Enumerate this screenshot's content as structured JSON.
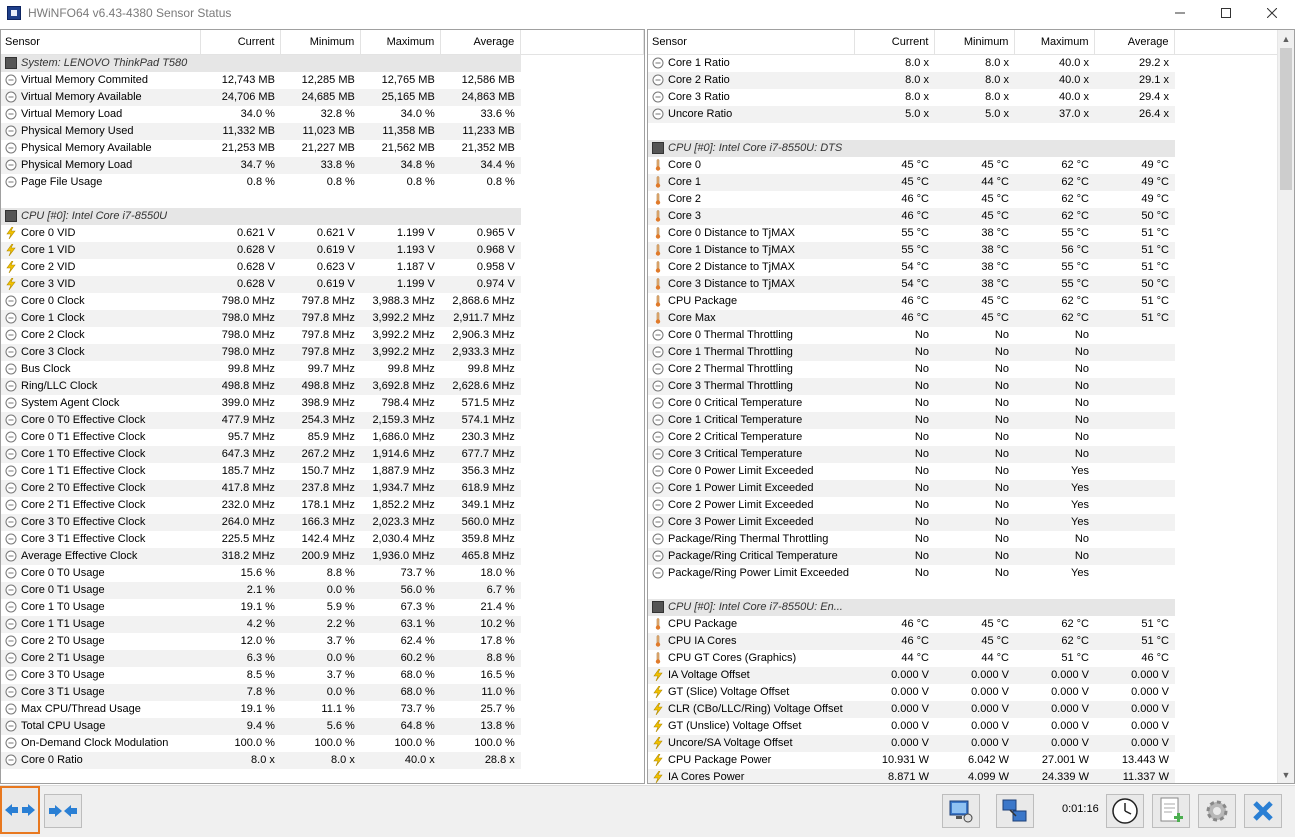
{
  "window": {
    "title": "HWiNFO64 v6.43-4380 Sensor Status",
    "controls": [
      "minimize-icon",
      "maximize-icon",
      "close-icon"
    ]
  },
  "columns": {
    "sensor": "Sensor",
    "current": "Current",
    "minimum": "Minimum",
    "maximum": "Maximum",
    "average": "Average"
  },
  "left_panel": {
    "rows": [
      {
        "type": "group",
        "name": "System: LENOVO ThinkPad T580",
        "icon": "device-icon"
      },
      {
        "type": "row",
        "icon": "clock-icon",
        "name": "Virtual Memory Commited",
        "current": "12,743 MB",
        "minimum": "12,285 MB",
        "maximum": "12,765 MB",
        "average": "12,586 MB"
      },
      {
        "type": "row",
        "icon": "clock-icon",
        "name": "Virtual Memory Available",
        "current": "24,706 MB",
        "minimum": "24,685 MB",
        "maximum": "25,165 MB",
        "average": "24,863 MB"
      },
      {
        "type": "row",
        "icon": "clock-icon",
        "name": "Virtual Memory Load",
        "current": "34.0 %",
        "minimum": "32.8 %",
        "maximum": "34.0 %",
        "average": "33.6 %"
      },
      {
        "type": "row",
        "icon": "clock-icon",
        "name": "Physical Memory Used",
        "current": "11,332 MB",
        "minimum": "11,023 MB",
        "maximum": "11,358 MB",
        "average": "11,233 MB"
      },
      {
        "type": "row",
        "icon": "clock-icon",
        "name": "Physical Memory Available",
        "current": "21,253 MB",
        "minimum": "21,227 MB",
        "maximum": "21,562 MB",
        "average": "21,352 MB"
      },
      {
        "type": "row",
        "icon": "clock-icon",
        "name": "Physical Memory Load",
        "current": "34.7 %",
        "minimum": "33.8 %",
        "maximum": "34.8 %",
        "average": "34.4 %"
      },
      {
        "type": "row",
        "icon": "clock-icon",
        "name": "Page File Usage",
        "current": "0.8 %",
        "minimum": "0.8 %",
        "maximum": "0.8 %",
        "average": "0.8 %"
      },
      {
        "type": "blank"
      },
      {
        "type": "group",
        "name": "CPU [#0]: Intel Core i7-8550U",
        "icon": "device-icon"
      },
      {
        "type": "row",
        "icon": "bolt-icon",
        "name": "Core 0 VID",
        "current": "0.621 V",
        "minimum": "0.621 V",
        "maximum": "1.199 V",
        "average": "0.965 V"
      },
      {
        "type": "row",
        "icon": "bolt-icon",
        "name": "Core 1 VID",
        "current": "0.628 V",
        "minimum": "0.619 V",
        "maximum": "1.193 V",
        "average": "0.968 V"
      },
      {
        "type": "row",
        "icon": "bolt-icon",
        "name": "Core 2 VID",
        "current": "0.628 V",
        "minimum": "0.623 V",
        "maximum": "1.187 V",
        "average": "0.958 V"
      },
      {
        "type": "row",
        "icon": "bolt-icon",
        "name": "Core 3 VID",
        "current": "0.628 V",
        "minimum": "0.619 V",
        "maximum": "1.199 V",
        "average": "0.974 V"
      },
      {
        "type": "row",
        "icon": "clock-icon",
        "name": "Core 0 Clock",
        "current": "798.0 MHz",
        "minimum": "797.8 MHz",
        "maximum": "3,988.3 MHz",
        "average": "2,868.6 MHz"
      },
      {
        "type": "row",
        "icon": "clock-icon",
        "name": "Core 1 Clock",
        "current": "798.0 MHz",
        "minimum": "797.8 MHz",
        "maximum": "3,992.2 MHz",
        "average": "2,911.7 MHz"
      },
      {
        "type": "row",
        "icon": "clock-icon",
        "name": "Core 2 Clock",
        "current": "798.0 MHz",
        "minimum": "797.8 MHz",
        "maximum": "3,992.2 MHz",
        "average": "2,906.3 MHz"
      },
      {
        "type": "row",
        "icon": "clock-icon",
        "name": "Core 3 Clock",
        "current": "798.0 MHz",
        "minimum": "797.8 MHz",
        "maximum": "3,992.2 MHz",
        "average": "2,933.3 MHz"
      },
      {
        "type": "row",
        "icon": "clock-icon",
        "name": "Bus Clock",
        "current": "99.8 MHz",
        "minimum": "99.7 MHz",
        "maximum": "99.8 MHz",
        "average": "99.8 MHz"
      },
      {
        "type": "row",
        "icon": "clock-icon",
        "name": "Ring/LLC Clock",
        "current": "498.8 MHz",
        "minimum": "498.8 MHz",
        "maximum": "3,692.8 MHz",
        "average": "2,628.6 MHz"
      },
      {
        "type": "row",
        "icon": "clock-icon",
        "name": "System Agent Clock",
        "current": "399.0 MHz",
        "minimum": "398.9 MHz",
        "maximum": "798.4 MHz",
        "average": "571.5 MHz"
      },
      {
        "type": "row",
        "icon": "clock-icon",
        "name": "Core 0 T0 Effective Clock",
        "current": "477.9 MHz",
        "minimum": "254.3 MHz",
        "maximum": "2,159.3 MHz",
        "average": "574.1 MHz"
      },
      {
        "type": "row",
        "icon": "clock-icon",
        "name": "Core 0 T1 Effective Clock",
        "current": "95.7 MHz",
        "minimum": "85.9 MHz",
        "maximum": "1,686.0 MHz",
        "average": "230.3 MHz"
      },
      {
        "type": "row",
        "icon": "clock-icon",
        "name": "Core 1 T0 Effective Clock",
        "current": "647.3 MHz",
        "minimum": "267.2 MHz",
        "maximum": "1,914.6 MHz",
        "average": "677.7 MHz"
      },
      {
        "type": "row",
        "icon": "clock-icon",
        "name": "Core 1 T1 Effective Clock",
        "current": "185.7 MHz",
        "minimum": "150.7 MHz",
        "maximum": "1,887.9 MHz",
        "average": "356.3 MHz"
      },
      {
        "type": "row",
        "icon": "clock-icon",
        "name": "Core 2 T0 Effective Clock",
        "current": "417.8 MHz",
        "minimum": "237.8 MHz",
        "maximum": "1,934.7 MHz",
        "average": "618.9 MHz"
      },
      {
        "type": "row",
        "icon": "clock-icon",
        "name": "Core 2 T1 Effective Clock",
        "current": "232.0 MHz",
        "minimum": "178.1 MHz",
        "maximum": "1,852.2 MHz",
        "average": "349.1 MHz"
      },
      {
        "type": "row",
        "icon": "clock-icon",
        "name": "Core 3 T0 Effective Clock",
        "current": "264.0 MHz",
        "minimum": "166.3 MHz",
        "maximum": "2,023.3 MHz",
        "average": "560.0 MHz"
      },
      {
        "type": "row",
        "icon": "clock-icon",
        "name": "Core 3 T1 Effective Clock",
        "current": "225.5 MHz",
        "minimum": "142.4 MHz",
        "maximum": "2,030.4 MHz",
        "average": "359.8 MHz"
      },
      {
        "type": "row",
        "icon": "clock-icon",
        "name": "Average Effective Clock",
        "current": "318.2 MHz",
        "minimum": "200.9 MHz",
        "maximum": "1,936.0 MHz",
        "average": "465.8 MHz"
      },
      {
        "type": "row",
        "icon": "clock-icon",
        "name": "Core 0 T0 Usage",
        "current": "15.6 %",
        "minimum": "8.8 %",
        "maximum": "73.7 %",
        "average": "18.0 %"
      },
      {
        "type": "row",
        "icon": "clock-icon",
        "name": "Core 0 T1 Usage",
        "current": "2.1 %",
        "minimum": "0.0 %",
        "maximum": "56.0 %",
        "average": "6.7 %"
      },
      {
        "type": "row",
        "icon": "clock-icon",
        "name": "Core 1 T0 Usage",
        "current": "19.1 %",
        "minimum": "5.9 %",
        "maximum": "67.3 %",
        "average": "21.4 %"
      },
      {
        "type": "row",
        "icon": "clock-icon",
        "name": "Core 1 T1 Usage",
        "current": "4.2 %",
        "minimum": "2.2 %",
        "maximum": "63.1 %",
        "average": "10.2 %"
      },
      {
        "type": "row",
        "icon": "clock-icon",
        "name": "Core 2 T0 Usage",
        "current": "12.0 %",
        "minimum": "3.7 %",
        "maximum": "62.4 %",
        "average": "17.8 %"
      },
      {
        "type": "row",
        "icon": "clock-icon",
        "name": "Core 2 T1 Usage",
        "current": "6.3 %",
        "minimum": "0.0 %",
        "maximum": "60.2 %",
        "average": "8.8 %"
      },
      {
        "type": "row",
        "icon": "clock-icon",
        "name": "Core 3 T0 Usage",
        "current": "8.5 %",
        "minimum": "3.7 %",
        "maximum": "68.0 %",
        "average": "16.5 %"
      },
      {
        "type": "row",
        "icon": "clock-icon",
        "name": "Core 3 T1 Usage",
        "current": "7.8 %",
        "minimum": "0.0 %",
        "maximum": "68.0 %",
        "average": "11.0 %"
      },
      {
        "type": "row",
        "icon": "clock-icon",
        "name": "Max CPU/Thread Usage",
        "current": "19.1 %",
        "minimum": "11.1 %",
        "maximum": "73.7 %",
        "average": "25.7 %"
      },
      {
        "type": "row",
        "icon": "clock-icon",
        "name": "Total CPU Usage",
        "current": "9.4 %",
        "minimum": "5.6 %",
        "maximum": "64.8 %",
        "average": "13.8 %"
      },
      {
        "type": "row",
        "icon": "clock-icon",
        "name": "On-Demand Clock Modulation",
        "current": "100.0 %",
        "minimum": "100.0 %",
        "maximum": "100.0 %",
        "average": "100.0 %"
      },
      {
        "type": "row",
        "icon": "clock-icon",
        "name": "Core 0 Ratio",
        "current": "8.0 x",
        "minimum": "8.0 x",
        "maximum": "40.0 x",
        "average": "28.8 x"
      }
    ]
  },
  "right_panel": {
    "rows": [
      {
        "type": "row",
        "icon": "clock-icon",
        "name": "Core 1 Ratio",
        "current": "8.0 x",
        "minimum": "8.0 x",
        "maximum": "40.0 x",
        "average": "29.2 x"
      },
      {
        "type": "row",
        "icon": "clock-icon",
        "name": "Core 2 Ratio",
        "current": "8.0 x",
        "minimum": "8.0 x",
        "maximum": "40.0 x",
        "average": "29.1 x"
      },
      {
        "type": "row",
        "icon": "clock-icon",
        "name": "Core 3 Ratio",
        "current": "8.0 x",
        "minimum": "8.0 x",
        "maximum": "40.0 x",
        "average": "29.4 x"
      },
      {
        "type": "row",
        "icon": "clock-icon",
        "name": "Uncore Ratio",
        "current": "5.0 x",
        "minimum": "5.0 x",
        "maximum": "37.0 x",
        "average": "26.4 x"
      },
      {
        "type": "blank"
      },
      {
        "type": "group",
        "name": "CPU [#0]: Intel Core i7-8550U: DTS",
        "icon": "device-icon"
      },
      {
        "type": "row",
        "icon": "thermometer-icon",
        "name": "Core 0",
        "current": "45 °C",
        "minimum": "45 °C",
        "maximum": "62 °C",
        "average": "49 °C"
      },
      {
        "type": "row",
        "icon": "thermometer-icon",
        "name": "Core 1",
        "current": "45 °C",
        "minimum": "44 °C",
        "maximum": "62 °C",
        "average": "49 °C"
      },
      {
        "type": "row",
        "icon": "thermometer-icon",
        "name": "Core 2",
        "current": "46 °C",
        "minimum": "45 °C",
        "maximum": "62 °C",
        "average": "49 °C"
      },
      {
        "type": "row",
        "icon": "thermometer-icon",
        "name": "Core 3",
        "current": "46 °C",
        "minimum": "45 °C",
        "maximum": "62 °C",
        "average": "50 °C"
      },
      {
        "type": "row",
        "icon": "thermometer-icon",
        "name": "Core 0 Distance to TjMAX",
        "current": "55 °C",
        "minimum": "38 °C",
        "maximum": "55 °C",
        "average": "51 °C"
      },
      {
        "type": "row",
        "icon": "thermometer-icon",
        "name": "Core 1 Distance to TjMAX",
        "current": "55 °C",
        "minimum": "38 °C",
        "maximum": "56 °C",
        "average": "51 °C"
      },
      {
        "type": "row",
        "icon": "thermometer-icon",
        "name": "Core 2 Distance to TjMAX",
        "current": "54 °C",
        "minimum": "38 °C",
        "maximum": "55 °C",
        "average": "51 °C"
      },
      {
        "type": "row",
        "icon": "thermometer-icon",
        "name": "Core 3 Distance to TjMAX",
        "current": "54 °C",
        "minimum": "38 °C",
        "maximum": "55 °C",
        "average": "50 °C"
      },
      {
        "type": "row",
        "icon": "thermometer-icon",
        "name": "CPU Package",
        "current": "46 °C",
        "minimum": "45 °C",
        "maximum": "62 °C",
        "average": "51 °C"
      },
      {
        "type": "row",
        "icon": "thermometer-icon",
        "name": "Core Max",
        "current": "46 °C",
        "minimum": "45 °C",
        "maximum": "62 °C",
        "average": "51 °C"
      },
      {
        "type": "row",
        "icon": "clock-icon",
        "name": "Core 0 Thermal Throttling",
        "current": "No",
        "minimum": "No",
        "maximum": "No",
        "average": ""
      },
      {
        "type": "row",
        "icon": "clock-icon",
        "name": "Core 1 Thermal Throttling",
        "current": "No",
        "minimum": "No",
        "maximum": "No",
        "average": ""
      },
      {
        "type": "row",
        "icon": "clock-icon",
        "name": "Core 2 Thermal Throttling",
        "current": "No",
        "minimum": "No",
        "maximum": "No",
        "average": ""
      },
      {
        "type": "row",
        "icon": "clock-icon",
        "name": "Core 3 Thermal Throttling",
        "current": "No",
        "minimum": "No",
        "maximum": "No",
        "average": ""
      },
      {
        "type": "row",
        "icon": "clock-icon",
        "name": "Core 0 Critical Temperature",
        "current": "No",
        "minimum": "No",
        "maximum": "No",
        "average": ""
      },
      {
        "type": "row",
        "icon": "clock-icon",
        "name": "Core 1 Critical Temperature",
        "current": "No",
        "minimum": "No",
        "maximum": "No",
        "average": ""
      },
      {
        "type": "row",
        "icon": "clock-icon",
        "name": "Core 2 Critical Temperature",
        "current": "No",
        "minimum": "No",
        "maximum": "No",
        "average": ""
      },
      {
        "type": "row",
        "icon": "clock-icon",
        "name": "Core 3 Critical Temperature",
        "current": "No",
        "minimum": "No",
        "maximum": "No",
        "average": ""
      },
      {
        "type": "row",
        "icon": "clock-icon",
        "name": "Core 0 Power Limit Exceeded",
        "current": "No",
        "minimum": "No",
        "maximum": "Yes",
        "average": ""
      },
      {
        "type": "row",
        "icon": "clock-icon",
        "name": "Core 1 Power Limit Exceeded",
        "current": "No",
        "minimum": "No",
        "maximum": "Yes",
        "average": ""
      },
      {
        "type": "row",
        "icon": "clock-icon",
        "name": "Core 2 Power Limit Exceeded",
        "current": "No",
        "minimum": "No",
        "maximum": "Yes",
        "average": ""
      },
      {
        "type": "row",
        "icon": "clock-icon",
        "name": "Core 3 Power Limit Exceeded",
        "current": "No",
        "minimum": "No",
        "maximum": "Yes",
        "average": ""
      },
      {
        "type": "row",
        "icon": "clock-icon",
        "name": "Package/Ring Thermal Throttling",
        "current": "No",
        "minimum": "No",
        "maximum": "No",
        "average": ""
      },
      {
        "type": "row",
        "icon": "clock-icon",
        "name": "Package/Ring Critical Temperature",
        "current": "No",
        "minimum": "No",
        "maximum": "No",
        "average": ""
      },
      {
        "type": "row",
        "icon": "clock-icon",
        "name": "Package/Ring Power Limit Exceeded",
        "current": "No",
        "minimum": "No",
        "maximum": "Yes",
        "average": ""
      },
      {
        "type": "blank"
      },
      {
        "type": "group",
        "name": "CPU [#0]: Intel Core i7-8550U: En...",
        "icon": "device-icon"
      },
      {
        "type": "row",
        "icon": "thermometer-icon",
        "name": "CPU Package",
        "current": "46 °C",
        "minimum": "45 °C",
        "maximum": "62 °C",
        "average": "51 °C"
      },
      {
        "type": "row",
        "icon": "thermometer-icon",
        "name": "CPU IA Cores",
        "current": "46 °C",
        "minimum": "45 °C",
        "maximum": "62 °C",
        "average": "51 °C"
      },
      {
        "type": "row",
        "icon": "thermometer-icon",
        "name": "CPU GT Cores (Graphics)",
        "current": "44 °C",
        "minimum": "44 °C",
        "maximum": "51 °C",
        "average": "46 °C"
      },
      {
        "type": "row",
        "icon": "bolt-icon",
        "name": "IA Voltage Offset",
        "current": "0.000 V",
        "minimum": "0.000 V",
        "maximum": "0.000 V",
        "average": "0.000 V"
      },
      {
        "type": "row",
        "icon": "bolt-icon",
        "name": "GT (Slice) Voltage Offset",
        "current": "0.000 V",
        "minimum": "0.000 V",
        "maximum": "0.000 V",
        "average": "0.000 V"
      },
      {
        "type": "row",
        "icon": "bolt-icon",
        "name": "CLR (CBo/LLC/Ring) Voltage Offset",
        "current": "0.000 V",
        "minimum": "0.000 V",
        "maximum": "0.000 V",
        "average": "0.000 V"
      },
      {
        "type": "row",
        "icon": "bolt-icon",
        "name": "GT (Unslice) Voltage Offset",
        "current": "0.000 V",
        "minimum": "0.000 V",
        "maximum": "0.000 V",
        "average": "0.000 V"
      },
      {
        "type": "row",
        "icon": "bolt-icon",
        "name": "Uncore/SA Voltage Offset",
        "current": "0.000 V",
        "minimum": "0.000 V",
        "maximum": "0.000 V",
        "average": "0.000 V"
      },
      {
        "type": "row",
        "icon": "bolt-icon",
        "name": "CPU Package Power",
        "current": "10.931 W",
        "minimum": "6.042 W",
        "maximum": "27.001 W",
        "average": "13.443 W"
      },
      {
        "type": "row",
        "icon": "bolt-icon",
        "name": "IA Cores Power",
        "current": "8.871 W",
        "minimum": "4.099 W",
        "maximum": "24.339 W",
        "average": "11.337 W"
      }
    ]
  },
  "toolbar": {
    "timer": "0:01:16",
    "buttons": {
      "expand": "expand-arrows-icon",
      "collapse": "collapse-arrows-icon",
      "network": "network-monitor-icon",
      "network2": "network-transfer-icon",
      "clock": "clock-reset-icon",
      "log": "log-add-icon",
      "settings": "gear-icon",
      "close": "close-icon"
    }
  }
}
